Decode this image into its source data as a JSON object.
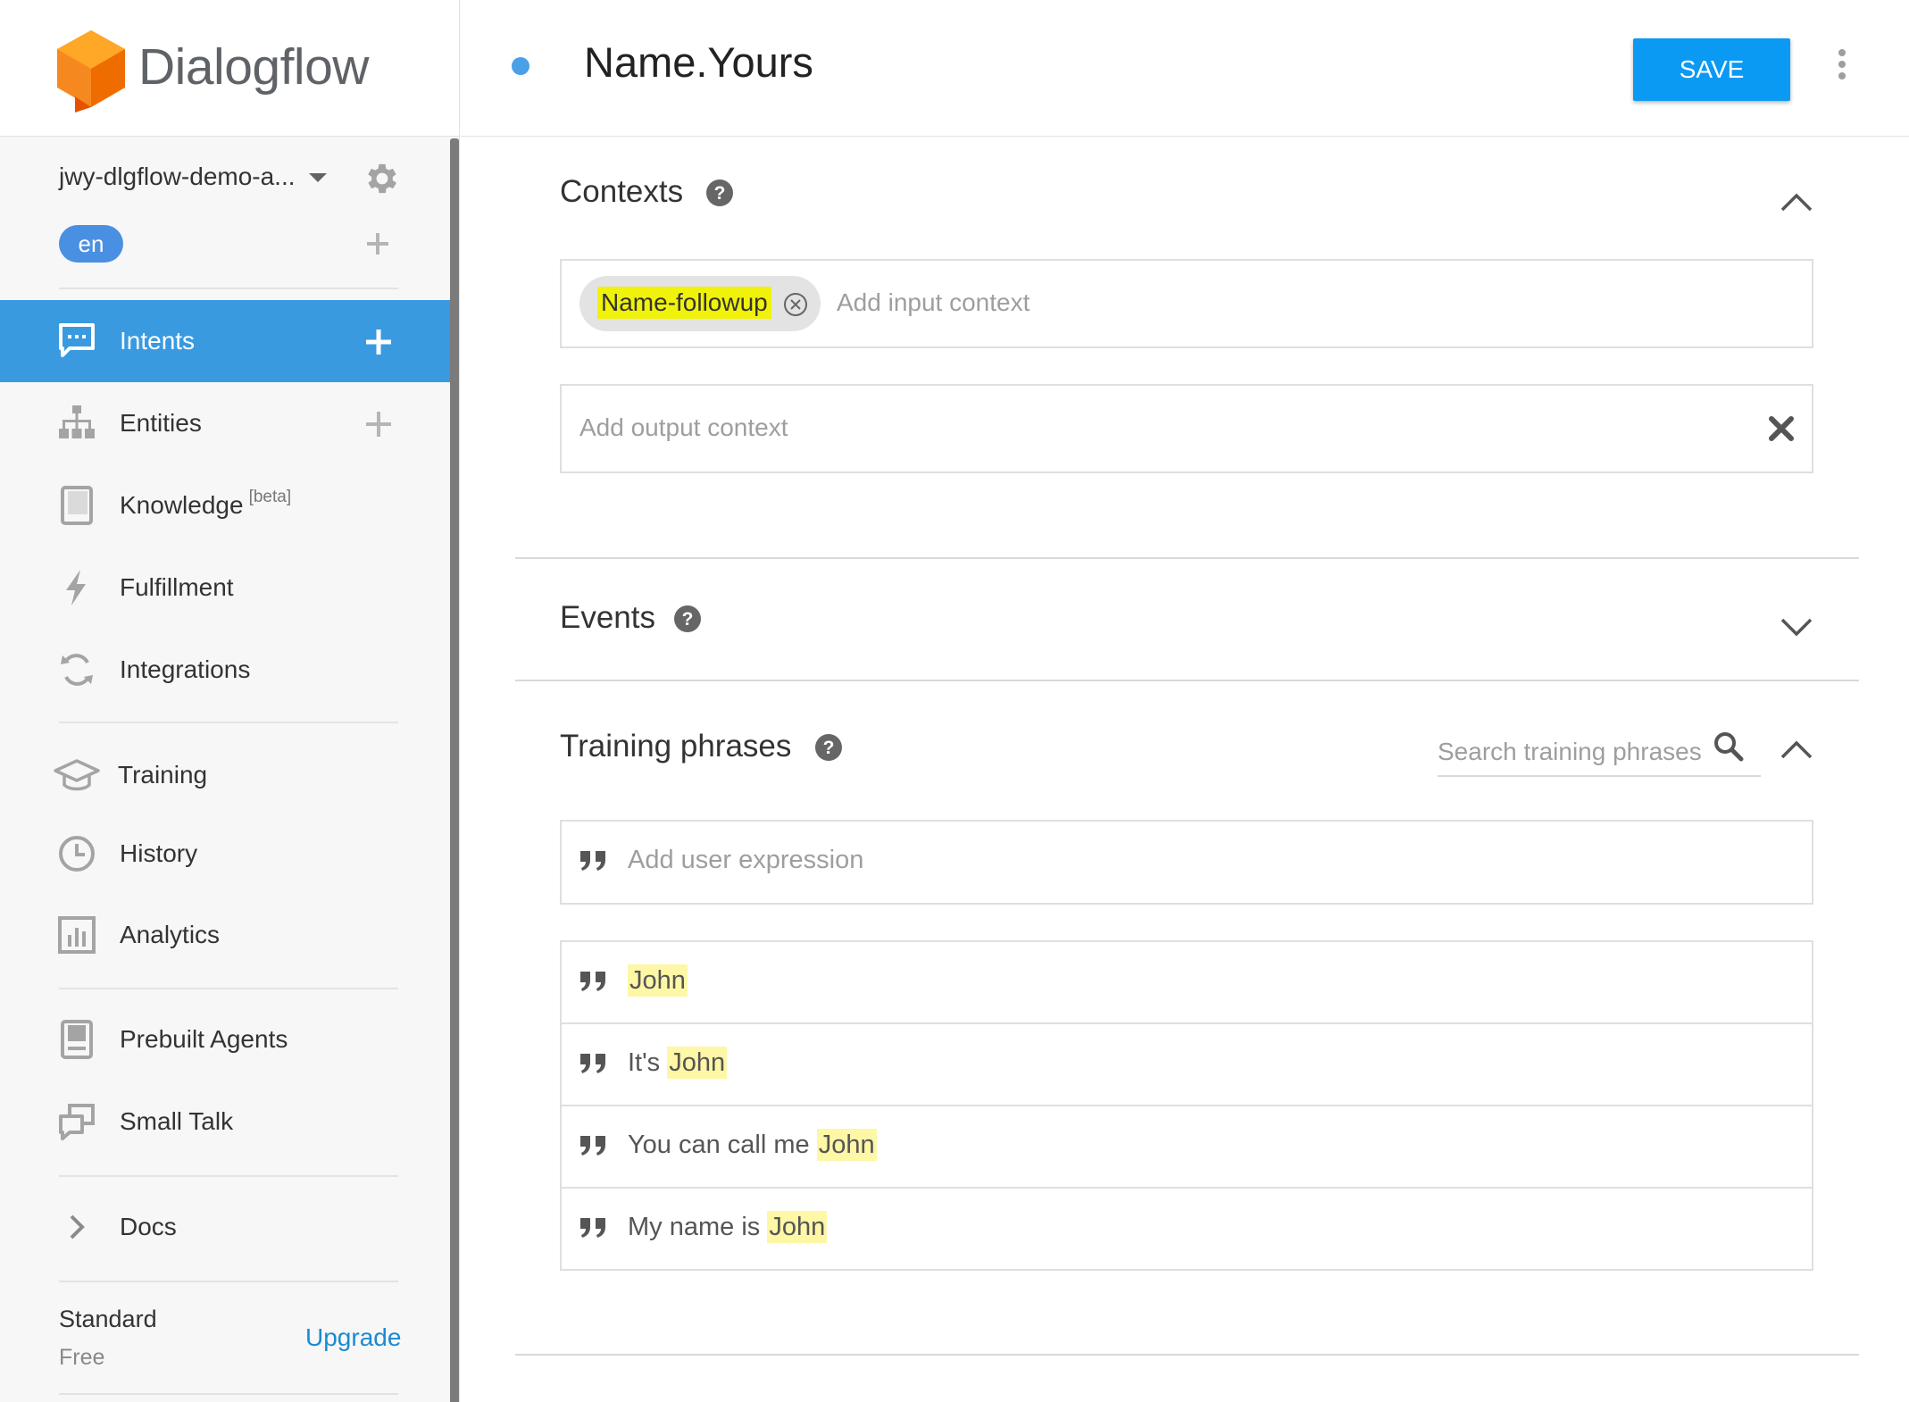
{
  "brand": {
    "name": "Dialogflow"
  },
  "agent": {
    "name": "jwy-dlgflow-demo-a...",
    "language": "en"
  },
  "nav": {
    "primary": [
      {
        "label": "Intents",
        "icon": "chat-icon",
        "active": true,
        "add": true
      },
      {
        "label": "Entities",
        "icon": "sitemap-icon",
        "active": false,
        "add": true
      },
      {
        "label": "Knowledge",
        "badge": "[beta]",
        "icon": "book-icon",
        "active": false,
        "add": false
      },
      {
        "label": "Fulfillment",
        "icon": "bolt-icon",
        "active": false,
        "add": false
      },
      {
        "label": "Integrations",
        "icon": "sync-icon",
        "active": false,
        "add": false
      }
    ],
    "secondary": [
      {
        "label": "Training",
        "icon": "graduation-cap-icon"
      },
      {
        "label": "History",
        "icon": "clock-icon"
      },
      {
        "label": "Analytics",
        "icon": "bar-chart-icon"
      }
    ],
    "tertiary": [
      {
        "label": "Prebuilt Agents",
        "icon": "agents-book-icon"
      },
      {
        "label": "Small Talk",
        "icon": "speech-bubbles-icon"
      }
    ],
    "docs": {
      "label": "Docs",
      "icon": "chevron-right-icon"
    }
  },
  "plan": {
    "name": "Standard",
    "tier": "Free",
    "upgrade_label": "Upgrade"
  },
  "header": {
    "intent_name": "Name.Yours",
    "save_label": "SAVE"
  },
  "contexts": {
    "title": "Contexts",
    "input_contexts": [
      "Name-followup"
    ],
    "input_placeholder": "Add input context",
    "output_placeholder": "Add output context"
  },
  "events": {
    "title": "Events"
  },
  "training": {
    "title": "Training phrases",
    "search_placeholder": "Search training phrases",
    "add_placeholder": "Add user expression",
    "phrases": [
      {
        "prefix": "",
        "entity": "John"
      },
      {
        "prefix": "It's ",
        "entity": "John"
      },
      {
        "prefix": "You can call me ",
        "entity": "John"
      },
      {
        "prefix": "My name is ",
        "entity": "John"
      }
    ]
  },
  "colors": {
    "accent": "#3a9ae0",
    "save_button": "#0a9af4",
    "status_dot": "#4a9fe6",
    "context_highlight": "#f0f20a",
    "entity_highlight": "#fdf7a6",
    "logo_orange": "#f27b1a",
    "link": "#1a8ad2"
  }
}
